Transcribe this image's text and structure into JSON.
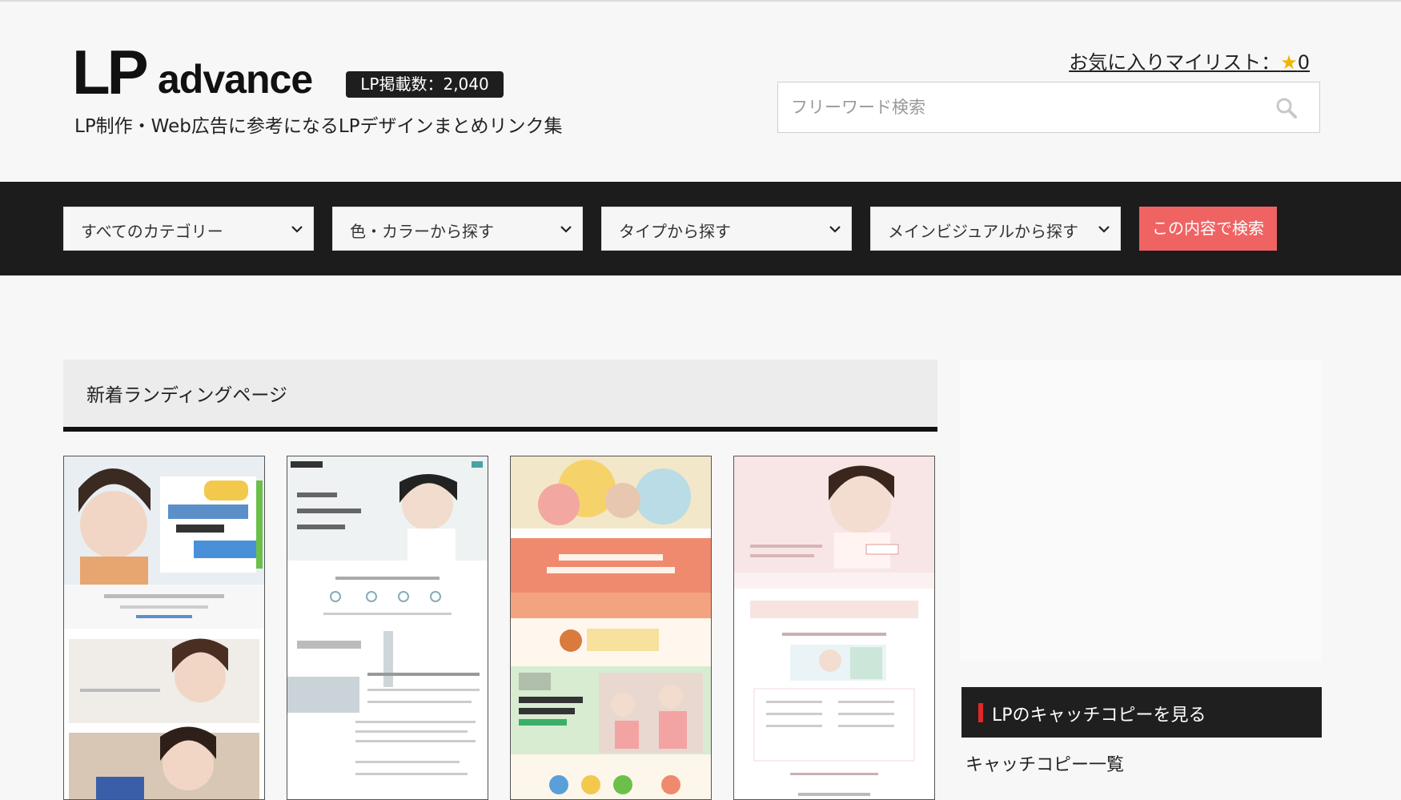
{
  "header": {
    "logo_lp": "LP",
    "logo_advance": "advance",
    "badge": "LP掲載数：2,040",
    "tagline": "LP制作・Web広告に参考になるLPデザインまとめリンク集",
    "favorites_label": "お気に入りマイリスト：",
    "favorites_count": "0",
    "search_placeholder": "フリーワード検索"
  },
  "filters": {
    "category": "すべてのカテゴリー",
    "color": "色・カラーから探す",
    "type": "タイプから探す",
    "main_visual": "メインビジュアルから探す",
    "submit": "この内容で検索"
  },
  "main": {
    "section_title": "新着ランディングページ"
  },
  "sidebar": {
    "catch_heading": "LPのキャッチコピーを見る",
    "catch_link": "キャッチコピー一覧"
  },
  "colors": {
    "accent": "#f06363",
    "nav_bg": "#1c1c1c",
    "star": "#f0b400"
  }
}
